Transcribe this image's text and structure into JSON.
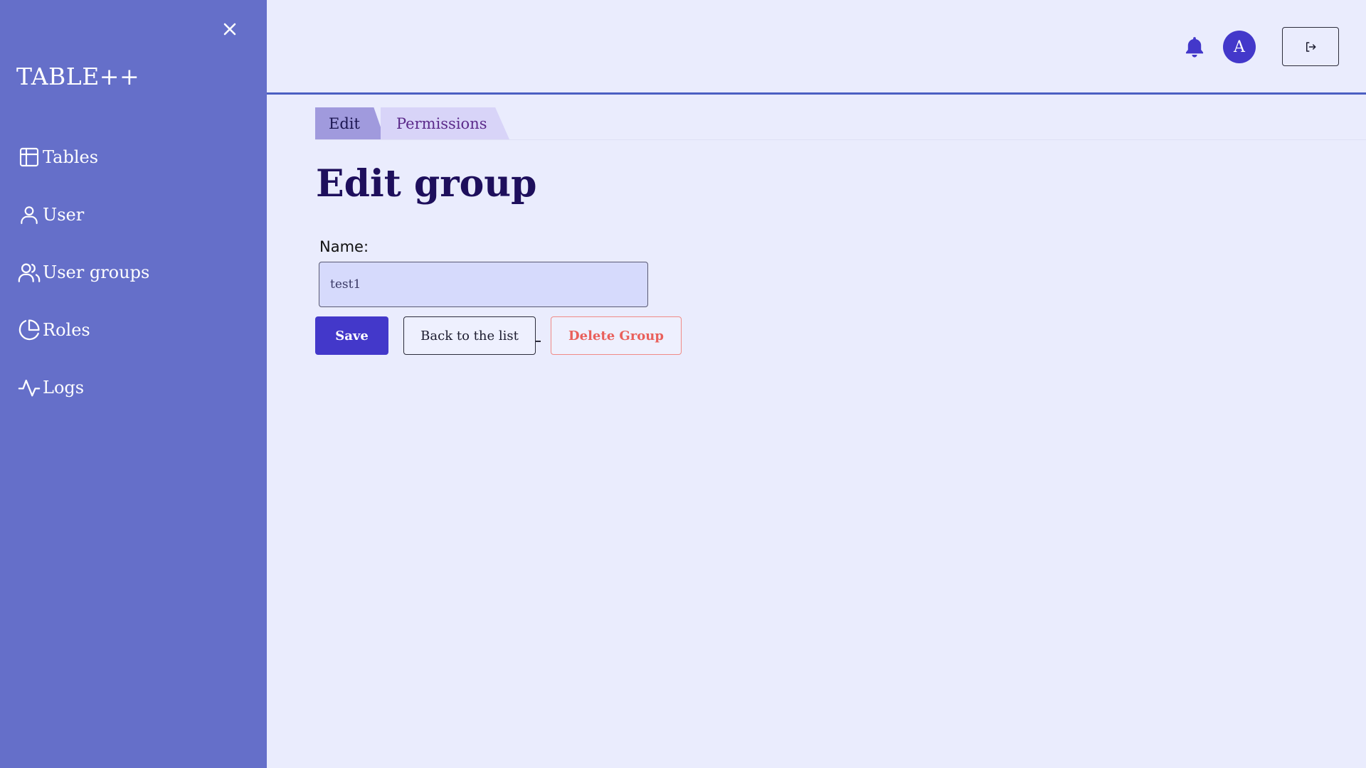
{
  "sidebar": {
    "brand": "TABLE++",
    "close_icon": "close-icon",
    "items": [
      {
        "label": "Tables",
        "icon": "table-icon"
      },
      {
        "label": "User",
        "icon": "user-icon"
      },
      {
        "label": "User groups",
        "icon": "users-icon"
      },
      {
        "label": "Roles",
        "icon": "pie-chart-icon"
      },
      {
        "label": "Logs",
        "icon": "activity-icon"
      }
    ]
  },
  "header": {
    "bell_icon": "bell-icon",
    "avatar_letter": "A",
    "logout_icon": "logout-icon"
  },
  "tabs": [
    {
      "label": "Edit",
      "active": true
    },
    {
      "label": "Permissions",
      "active": false
    }
  ],
  "main": {
    "title": "Edit group",
    "name_label": "Name:",
    "name_value": "test1",
    "save_label": "Save",
    "back_label": "Back to the list",
    "delete_label": "Delete Group"
  },
  "colors": {
    "sidebar_bg": "#656fc9",
    "page_bg": "#eaecfd",
    "primary": "#4338ca",
    "danger": "#e9605b",
    "title": "#1e0f5c"
  }
}
